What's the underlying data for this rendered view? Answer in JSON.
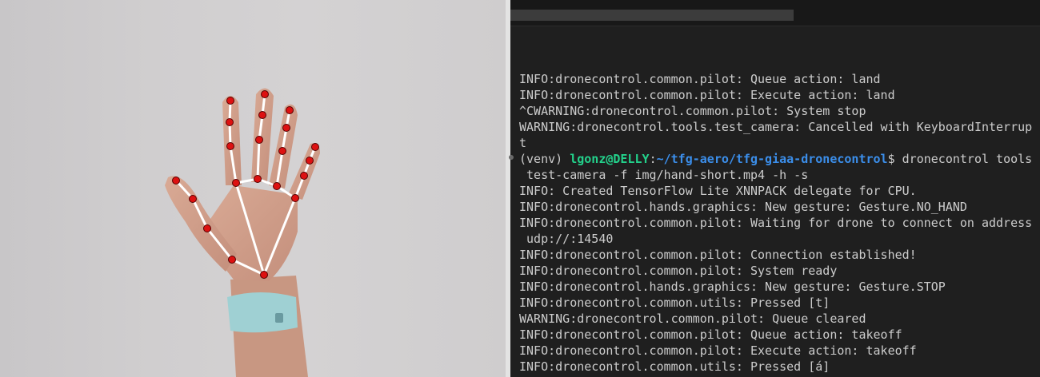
{
  "camera": {
    "overlay_colors": {
      "landmark": "#dd1111",
      "bone": "#ffffff"
    }
  },
  "terminal": {
    "lines": [
      {
        "type": "text",
        "text": "INFO:dronecontrol.common.pilot: Queue action: land"
      },
      {
        "type": "text",
        "text": "INFO:dronecontrol.common.pilot: Execute action: land"
      },
      {
        "type": "text",
        "text": "^CWARNING:dronecontrol.common.pilot: System stop"
      },
      {
        "type": "text",
        "text": "WARNING:dronecontrol.tools.test_camera: Cancelled with KeyboardInterrup"
      },
      {
        "type": "text",
        "text": "t"
      },
      {
        "type": "prompt",
        "venv": "(venv) ",
        "user": "lgonz@DELLY",
        "sep": ":",
        "path": "~/tfg-aero/tfg-giaa-dronecontrol",
        "dollar": "$ ",
        "command": "dronecontrol tools"
      },
      {
        "type": "text",
        "text": " test-camera -f img/hand-short.mp4 -h -s"
      },
      {
        "type": "text",
        "text": "INFO: Created TensorFlow Lite XNNPACK delegate for CPU."
      },
      {
        "type": "text",
        "text": "INFO:dronecontrol.hands.graphics: New gesture: Gesture.NO_HAND"
      },
      {
        "type": "text",
        "text": "INFO:dronecontrol.common.pilot: Waiting for drone to connect on address"
      },
      {
        "type": "text",
        "text": " udp://:14540"
      },
      {
        "type": "text",
        "text": "INFO:dronecontrol.common.pilot: Connection established!"
      },
      {
        "type": "text",
        "text": "INFO:dronecontrol.common.pilot: System ready"
      },
      {
        "type": "text",
        "text": "INFO:dronecontrol.hands.graphics: New gesture: Gesture.STOP"
      },
      {
        "type": "text",
        "text": "INFO:dronecontrol.common.utils: Pressed [t]"
      },
      {
        "type": "text",
        "text": "WARNING:dronecontrol.common.pilot: Queue cleared"
      },
      {
        "type": "text",
        "text": "INFO:dronecontrol.common.pilot: Queue action: takeoff"
      },
      {
        "type": "text",
        "text": "INFO:dronecontrol.common.pilot: Execute action: takeoff"
      },
      {
        "type": "text",
        "text": "INFO:dronecontrol.common.utils: Pressed [á]"
      }
    ]
  }
}
